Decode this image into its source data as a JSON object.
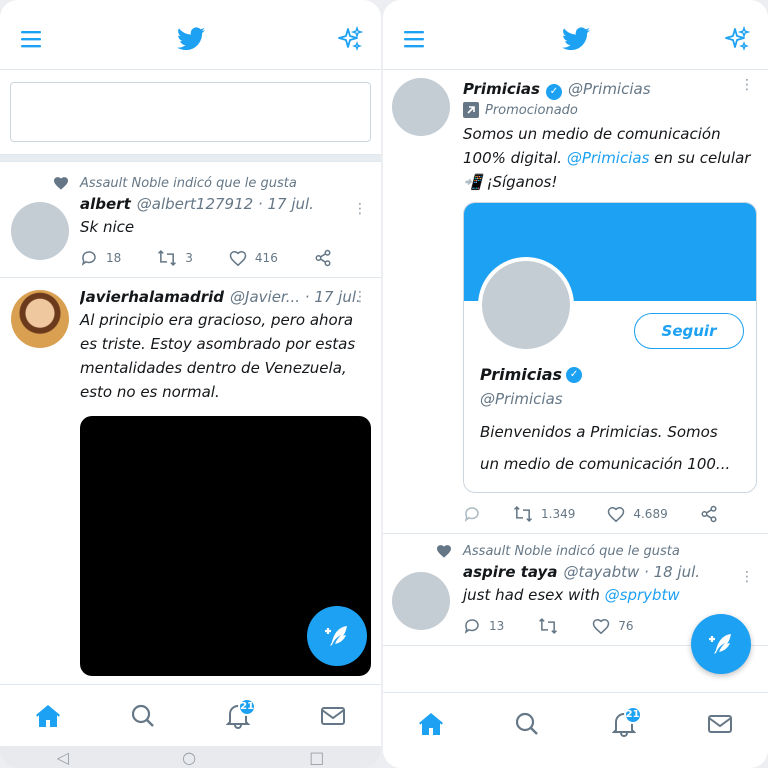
{
  "left": {
    "compose_placeholder": "",
    "tweets": [
      {
        "social": "Assault Noble indicó que le gusta",
        "name": "albert",
        "handle": "@albert127912 · 17 jul.",
        "text": "Sk nice",
        "replies": "18",
        "retweets": "3",
        "likes": "416"
      },
      {
        "name": "Javierhalamadrid",
        "handle": "@Javier... · 17 jul.",
        "text": "Al principio era gracioso, pero ahora es triste. Estoy asombrado por estas mentalidades dentro de Venezuela, esto no es normal."
      }
    ],
    "notif_badge": "21"
  },
  "right": {
    "promo_tweet": {
      "name": "Primicias",
      "handle": "@Primicias",
      "promoted": "Promocionado",
      "text_a": "Somos un medio de comunicación 100% digital. ",
      "mention": "@Primicias",
      "text_b": " en su celular 📲 ¡Síganos!",
      "card_follow": "Seguir",
      "card_name": "Primicias",
      "card_handle": "@Primicias",
      "card_bio": "Bienvenidos a Primicias. Somos un medio de comunicación 100...",
      "retweets": "1.349",
      "likes": "4.689"
    },
    "tweet2": {
      "social": "Assault Noble indicó que le gusta",
      "name": "aspire taya",
      "handle": "@tayabtw · 18 jul.",
      "text_a": "just had esex with ",
      "mention": "@sprybtw",
      "replies": "13",
      "likes": "76"
    },
    "notif_badge": "21"
  },
  "colors": {
    "accent": "#1da1f2",
    "muted": "#657786"
  }
}
